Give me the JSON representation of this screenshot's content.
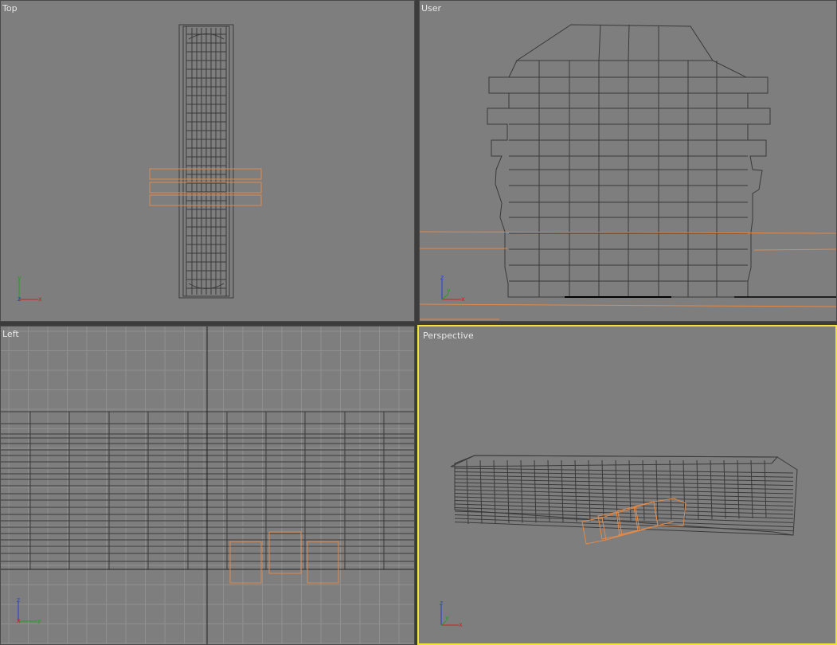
{
  "viewports": {
    "top": {
      "label": "Top",
      "active": false
    },
    "user": {
      "label": "User",
      "active": false
    },
    "left": {
      "label": "Left",
      "active": false
    },
    "perspective": {
      "label": "Perspective",
      "active": true
    }
  },
  "axis_labels": {
    "x": "x",
    "y": "y",
    "z": "z"
  },
  "colors": {
    "viewport_bg": "#7e7e7e",
    "wire": "#3a3a3a",
    "selection": "#e08a4a",
    "active_border": "#f0e43a",
    "axis_x": "#d02020",
    "axis_y": "#20a020",
    "axis_z": "#2040d0"
  }
}
